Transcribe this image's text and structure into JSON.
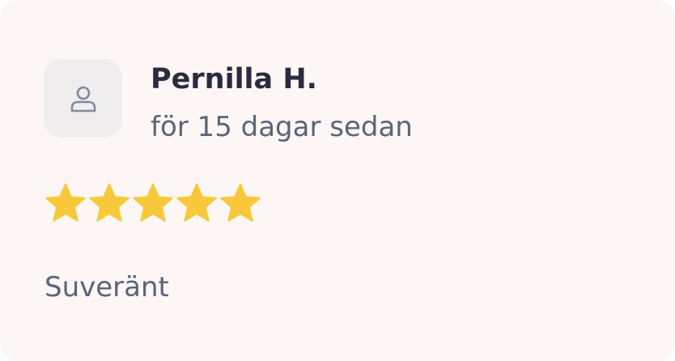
{
  "review": {
    "avatar_icon": "user-icon",
    "reviewer_name": "Pernilla H.",
    "date": "för 15 dagar sedan",
    "rating": 5,
    "rating_max": 5,
    "star_icon": "star-icon",
    "text": "Suveränt"
  },
  "colors": {
    "card_background": "#fcf6f4",
    "avatar_background": "#efedee",
    "name": "#2b2b3f",
    "secondary_text": "#5a6578",
    "star": "#f7c93a"
  }
}
